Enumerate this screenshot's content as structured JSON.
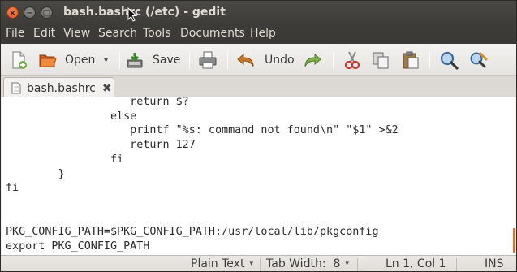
{
  "window": {
    "title": "bash.bashrc (/etc) - gedit",
    "buttons": {
      "close": "×",
      "minimize": "−",
      "maximize": "□"
    }
  },
  "menu": {
    "items": [
      "File",
      "Edit",
      "View",
      "Search",
      "Tools",
      "Documents",
      "Help"
    ]
  },
  "toolbar": {
    "new_icon": "new-document-icon",
    "open_label": "Open",
    "open_icon": "folder-open-icon",
    "open_dropdown": "▾",
    "save_label": "Save",
    "save_icon": "save-icon",
    "print_icon": "print-icon",
    "undo_label": "Undo",
    "undo_icon": "undo-arrow-icon",
    "redo_icon": "redo-arrow-icon",
    "cut_icon": "scissors-icon",
    "copy_icon": "copy-icon",
    "paste_icon": "paste-icon",
    "search_icon": "magnifier-icon",
    "replace_icon": "search-replace-icon"
  },
  "tab": {
    "label": "bash.bashrc",
    "close": "✖"
  },
  "editor": {
    "lines": [
      "\t\t   return $?",
      "\t\telse",
      "\t\t   printf \"%s: command not found\\n\" \"$1\" >&2",
      "\t\t   return 127",
      "\t\tfi",
      "\t}",
      "fi",
      "",
      "",
      "PKG_CONFIG_PATH=$PKG_CONFIG_PATH:/usr/local/lib/pkgconfig",
      "export PKG_CONFIG_PATH"
    ]
  },
  "status": {
    "language": "Plain Text",
    "tab_width": "Tab Width:  8",
    "position": "Ln 1, Col 1",
    "mode": "INS",
    "dropdown_arrow": "▾"
  },
  "colors": {
    "titlebar": "#3d3c38",
    "close_button": "#e0521e",
    "scroll_marker": "#e3702b"
  }
}
